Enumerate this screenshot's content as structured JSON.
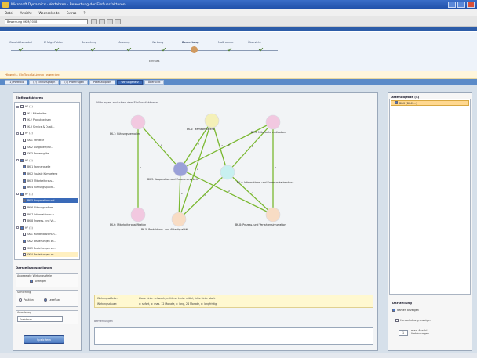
{
  "window": {
    "title": "Microsoft Dynamics · Verfahren · Bewertung der Einflussfaktoren"
  },
  "menu": [
    "Datei",
    "Ansicht",
    "Wechselseite",
    "Extras",
    "?"
  ],
  "address": {
    "value": "Bewertung OKM/2008"
  },
  "process": {
    "steps": [
      {
        "label": "Geschäftsmodell",
        "state": "done"
      },
      {
        "label": "Erfolgs-Faktor",
        "state": "done"
      },
      {
        "label": "Bewertung",
        "state": "done"
      },
      {
        "label": "Messung",
        "state": "done"
      },
      {
        "label": "Wirkung",
        "state": "done"
      },
      {
        "label": "Bewertung",
        "state": "active"
      },
      {
        "label": "Maßnahme",
        "state": "done"
      },
      {
        "label": "Übersicht",
        "state": "done"
      }
    ],
    "sublabel": "Einfluss"
  },
  "warning": "Hinweis: Einflussfaktoren bewerten",
  "tabs": [
    {
      "label": "(1) Portfolio"
    },
    {
      "label": "(2) Einflussgraph"
    },
    {
      "label": "(3) Profilfragen"
    },
    {
      "label": "Potenzialprofil"
    },
    {
      "label": "Wirkungsnetz",
      "active": true
    },
    {
      "label": "Übersicht"
    }
  ],
  "left": {
    "title": "Einflussfaktoren",
    "tree": [
      {
        "label": "HF (1)",
        "level": 0,
        "checked": false
      },
      {
        "label": "IK-1 Mitarbeiter",
        "level": 1,
        "checked": false
      },
      {
        "label": "IK-2 Produktwissen",
        "level": 1,
        "checked": false
      },
      {
        "label": "IK-3 Service & Quali...",
        "level": 1,
        "checked": false
      },
      {
        "label": "HF (2)",
        "level": 0,
        "checked": false
      },
      {
        "label": "SK-1 Struktur",
        "level": 1,
        "checked": false
      },
      {
        "label": "SK-2 Ausgaben/Inv...",
        "level": 1,
        "checked": false
      },
      {
        "label": "SK-3 Prozessgüte",
        "level": 1,
        "checked": false
      },
      {
        "label": "HF (3)",
        "level": 0,
        "checked": true
      },
      {
        "label": "BK-1 Partnerquelle",
        "level": 1,
        "checked": true
      },
      {
        "label": "BK-2 Soziale Kompetenz",
        "level": 1,
        "checked": true
      },
      {
        "label": "BK-3 Mitarbeiterzus...",
        "level": 1,
        "checked": true
      },
      {
        "label": "BK-4 Führungsqualit...",
        "level": 1,
        "checked": true
      },
      {
        "label": "HF (4)",
        "level": 0,
        "checked": true
      },
      {
        "label": "BK-5 Kooperation und...",
        "level": 1,
        "checked": true,
        "selected": true
      },
      {
        "label": "BK-6 Führungsinform...",
        "level": 1,
        "checked": false
      },
      {
        "label": "BK-7 Informationen u...",
        "level": 1,
        "checked": false
      },
      {
        "label": "BK-8 Prozess- und Ve...",
        "level": 1,
        "checked": false
      },
      {
        "label": "HF (5)",
        "level": 0,
        "checked": true
      },
      {
        "label": "SK-1 Kundenbeziehun...",
        "level": 1,
        "checked": false
      },
      {
        "label": "SK-2 Beziehungen zu...",
        "level": 1,
        "checked": true
      },
      {
        "label": "SK-3 Beziehungen zu...",
        "level": 1,
        "checked": false
      },
      {
        "label": "SK-4 Beziehungen zu...",
        "level": 1,
        "checked": false,
        "highlight": true
      }
    ],
    "options_title": "Darstellungsoptionen",
    "group_label": "Angezeigte Wirkungspfeile",
    "group_check": "Anzeigen",
    "sort_label": "Sortierung",
    "sort_options": [
      "Position",
      "Lesefluss"
    ],
    "sort_selected": "Lesefluss",
    "view_label": "Anordnung",
    "view_value": "Kreisform",
    "action_button": "Speichern"
  },
  "graph": {
    "title": "Wirkungen zwischen den Einflussfaktoren",
    "nodes": [
      {
        "id": "n1",
        "label": "BK-1: Führungsverhalten",
        "color": "#f2c8e0"
      },
      {
        "id": "n2",
        "label": "BK-1: Teamkompetenz",
        "color": "#f4f0b8"
      },
      {
        "id": "n3",
        "label": "BK-3: Mitarbeitermotivation",
        "color": "#f2c8e0"
      },
      {
        "id": "n4",
        "label": "BK-3: Kooperation und Zusammenarbeit",
        "color": "#9aa0d8"
      },
      {
        "id": "n5",
        "label": "BK-4: Informations- und Kommunikationsfluss",
        "color": "#c8f0f0"
      },
      {
        "id": "n6",
        "label": "BK-6: Mitarbeiterqualifikation",
        "color": "#f2c8e0"
      },
      {
        "id": "n7",
        "label": "BK-5: Produktions- und Ablaufqualität",
        "color": "#f8dcc4"
      },
      {
        "id": "n8",
        "label": "BK-8: Prozess- und Verfahrensinnovation",
        "color": "#f8dcc4"
      }
    ],
    "edge_weight": "2"
  },
  "legend": {
    "line1_label": "Wirkungsstärke:",
    "line1_value": "blaue Linie: schwach, mittlerer Linie: mittel, fette Linie: stark",
    "line2_label": "Wirkungsdauer:",
    "line2_value": "x: sofort, b: max. 12 Monate, c: lang, 24 Monate, d: langfristig"
  },
  "notes": {
    "label": "Bemerkungen"
  },
  "right": {
    "title": "Datenobjekte (4)",
    "selected_item": "BK-2 (BK-2 ...)",
    "options_title": "Darstellung",
    "check1": "Namen anzeigen",
    "check2": "Hervorhebung anzeigen",
    "spin_value": "1",
    "spin_label": "max. Anzahl Verbindungen"
  },
  "colors": {
    "accent": "#3a6ab8",
    "edge": "#7ab830",
    "warning": "#c06010"
  }
}
